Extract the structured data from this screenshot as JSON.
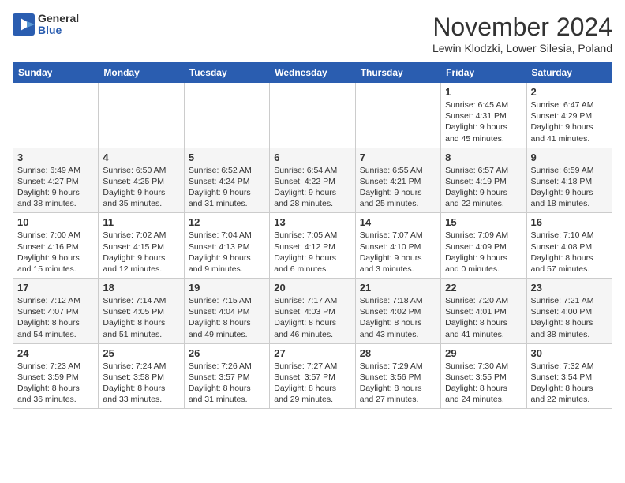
{
  "logo": {
    "general": "General",
    "blue": "Blue"
  },
  "title": "November 2024",
  "location": "Lewin Klodzki, Lower Silesia, Poland",
  "headers": [
    "Sunday",
    "Monday",
    "Tuesday",
    "Wednesday",
    "Thursday",
    "Friday",
    "Saturday"
  ],
  "weeks": [
    [
      {
        "day": "",
        "info": ""
      },
      {
        "day": "",
        "info": ""
      },
      {
        "day": "",
        "info": ""
      },
      {
        "day": "",
        "info": ""
      },
      {
        "day": "",
        "info": ""
      },
      {
        "day": "1",
        "info": "Sunrise: 6:45 AM\nSunset: 4:31 PM\nDaylight: 9 hours\nand 45 minutes."
      },
      {
        "day": "2",
        "info": "Sunrise: 6:47 AM\nSunset: 4:29 PM\nDaylight: 9 hours\nand 41 minutes."
      }
    ],
    [
      {
        "day": "3",
        "info": "Sunrise: 6:49 AM\nSunset: 4:27 PM\nDaylight: 9 hours\nand 38 minutes."
      },
      {
        "day": "4",
        "info": "Sunrise: 6:50 AM\nSunset: 4:25 PM\nDaylight: 9 hours\nand 35 minutes."
      },
      {
        "day": "5",
        "info": "Sunrise: 6:52 AM\nSunset: 4:24 PM\nDaylight: 9 hours\nand 31 minutes."
      },
      {
        "day": "6",
        "info": "Sunrise: 6:54 AM\nSunset: 4:22 PM\nDaylight: 9 hours\nand 28 minutes."
      },
      {
        "day": "7",
        "info": "Sunrise: 6:55 AM\nSunset: 4:21 PM\nDaylight: 9 hours\nand 25 minutes."
      },
      {
        "day": "8",
        "info": "Sunrise: 6:57 AM\nSunset: 4:19 PM\nDaylight: 9 hours\nand 22 minutes."
      },
      {
        "day": "9",
        "info": "Sunrise: 6:59 AM\nSunset: 4:18 PM\nDaylight: 9 hours\nand 18 minutes."
      }
    ],
    [
      {
        "day": "10",
        "info": "Sunrise: 7:00 AM\nSunset: 4:16 PM\nDaylight: 9 hours\nand 15 minutes."
      },
      {
        "day": "11",
        "info": "Sunrise: 7:02 AM\nSunset: 4:15 PM\nDaylight: 9 hours\nand 12 minutes."
      },
      {
        "day": "12",
        "info": "Sunrise: 7:04 AM\nSunset: 4:13 PM\nDaylight: 9 hours\nand 9 minutes."
      },
      {
        "day": "13",
        "info": "Sunrise: 7:05 AM\nSunset: 4:12 PM\nDaylight: 9 hours\nand 6 minutes."
      },
      {
        "day": "14",
        "info": "Sunrise: 7:07 AM\nSunset: 4:10 PM\nDaylight: 9 hours\nand 3 minutes."
      },
      {
        "day": "15",
        "info": "Sunrise: 7:09 AM\nSunset: 4:09 PM\nDaylight: 9 hours\nand 0 minutes."
      },
      {
        "day": "16",
        "info": "Sunrise: 7:10 AM\nSunset: 4:08 PM\nDaylight: 8 hours\nand 57 minutes."
      }
    ],
    [
      {
        "day": "17",
        "info": "Sunrise: 7:12 AM\nSunset: 4:07 PM\nDaylight: 8 hours\nand 54 minutes."
      },
      {
        "day": "18",
        "info": "Sunrise: 7:14 AM\nSunset: 4:05 PM\nDaylight: 8 hours\nand 51 minutes."
      },
      {
        "day": "19",
        "info": "Sunrise: 7:15 AM\nSunset: 4:04 PM\nDaylight: 8 hours\nand 49 minutes."
      },
      {
        "day": "20",
        "info": "Sunrise: 7:17 AM\nSunset: 4:03 PM\nDaylight: 8 hours\nand 46 minutes."
      },
      {
        "day": "21",
        "info": "Sunrise: 7:18 AM\nSunset: 4:02 PM\nDaylight: 8 hours\nand 43 minutes."
      },
      {
        "day": "22",
        "info": "Sunrise: 7:20 AM\nSunset: 4:01 PM\nDaylight: 8 hours\nand 41 minutes."
      },
      {
        "day": "23",
        "info": "Sunrise: 7:21 AM\nSunset: 4:00 PM\nDaylight: 8 hours\nand 38 minutes."
      }
    ],
    [
      {
        "day": "24",
        "info": "Sunrise: 7:23 AM\nSunset: 3:59 PM\nDaylight: 8 hours\nand 36 minutes."
      },
      {
        "day": "25",
        "info": "Sunrise: 7:24 AM\nSunset: 3:58 PM\nDaylight: 8 hours\nand 33 minutes."
      },
      {
        "day": "26",
        "info": "Sunrise: 7:26 AM\nSunset: 3:57 PM\nDaylight: 8 hours\nand 31 minutes."
      },
      {
        "day": "27",
        "info": "Sunrise: 7:27 AM\nSunset: 3:57 PM\nDaylight: 8 hours\nand 29 minutes."
      },
      {
        "day": "28",
        "info": "Sunrise: 7:29 AM\nSunset: 3:56 PM\nDaylight: 8 hours\nand 27 minutes."
      },
      {
        "day": "29",
        "info": "Sunrise: 7:30 AM\nSunset: 3:55 PM\nDaylight: 8 hours\nand 24 minutes."
      },
      {
        "day": "30",
        "info": "Sunrise: 7:32 AM\nSunset: 3:54 PM\nDaylight: 8 hours\nand 22 minutes."
      }
    ]
  ]
}
